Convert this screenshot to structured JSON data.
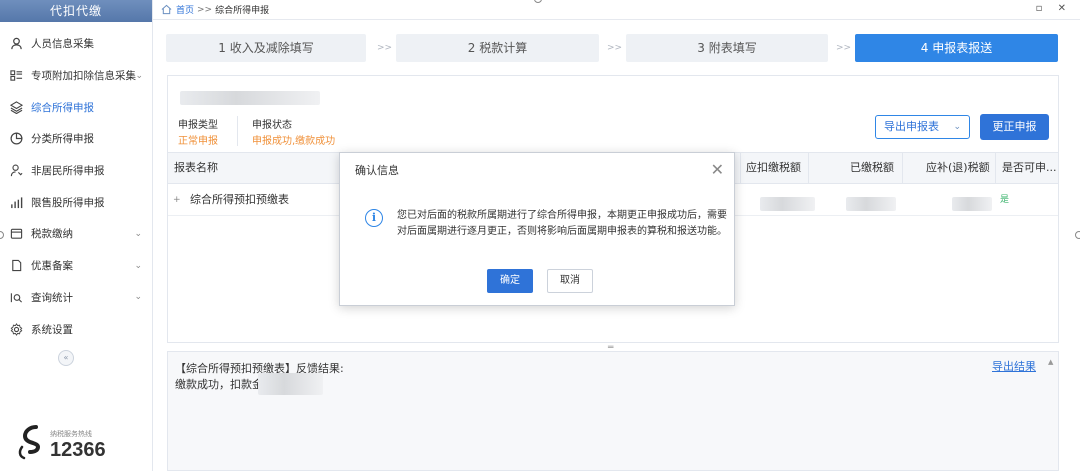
{
  "sidebar": {
    "title": "代扣代缴",
    "items": [
      {
        "label": "人员信息采集",
        "icon": "person-icon",
        "active": false,
        "chevron": false
      },
      {
        "label": "专项附加扣除信息采集",
        "icon": "grid-list-icon",
        "active": false,
        "chevron": true
      },
      {
        "label": "综合所得申报",
        "icon": "layers-icon",
        "active": true,
        "chevron": false
      },
      {
        "label": "分类所得申报",
        "icon": "pie-clock-icon",
        "active": false,
        "chevron": false
      },
      {
        "label": "非居民所得申报",
        "icon": "person-outline-icon",
        "active": false,
        "chevron": false
      },
      {
        "label": "限售股所得申报",
        "icon": "bar-chart-icon",
        "active": false,
        "chevron": false
      },
      {
        "label": "税款缴纳",
        "icon": "wallet-icon",
        "active": false,
        "chevron": true
      },
      {
        "label": "优惠备案",
        "icon": "document-icon",
        "active": false,
        "chevron": true
      },
      {
        "label": "查询统计",
        "icon": "search-list-icon",
        "active": false,
        "chevron": true
      },
      {
        "label": "系统设置",
        "icon": "gear-icon",
        "active": false,
        "chevron": false
      }
    ],
    "collapse_glyph": "«",
    "hotline_caption": "纳税服务热线",
    "hotline_number": "12366"
  },
  "breadcrumb": {
    "home": "首页",
    "separator": ">>",
    "current": "综合所得申报"
  },
  "window_controls": "▫ ✕",
  "steps": [
    {
      "label": "1 收入及减除填写",
      "active": false
    },
    {
      "label": "2 税款计算",
      "active": false
    },
    {
      "label": "3 附表填写",
      "active": false
    },
    {
      "label": "4 申报表报送",
      "active": true
    }
  ],
  "step_arrow": ">>",
  "declaration": {
    "type_label": "申报类型",
    "type_value": "正常申报",
    "status_label": "申报状态",
    "status_value": "申报成功,缴款成功"
  },
  "buttons": {
    "export": "导出申报表",
    "export_caret": "⌄",
    "amend": "更正申报"
  },
  "table": {
    "headers": [
      "报表名称",
      "应扣缴税额",
      "已缴税额",
      "应补(退)税额",
      "是否可申..."
    ],
    "rows": [
      {
        "expander": "+",
        "name": "综合所得预扣预缴表",
        "flag": "是"
      }
    ]
  },
  "feedback": {
    "title": "【综合所得预扣预缴表】反馈结果:",
    "body": "缴款成功，扣款金额",
    "export_link": "导出结果",
    "grip": "═"
  },
  "modal": {
    "title": "确认信息",
    "close": "✕",
    "icon_glyph": "i",
    "message": "您已对后面的税款所属期进行了综合所得申报，本期更正申报成功后，需要对后面属期进行逐月更正，否则将影响后面属期申报表的算税和报送功能。",
    "ok": "确定",
    "cancel": "取消"
  },
  "colors": {
    "primary": "#2f73d8",
    "step_active": "#2f86e6",
    "warning": "#f0913a",
    "sidebar_header": "#5577aa"
  }
}
